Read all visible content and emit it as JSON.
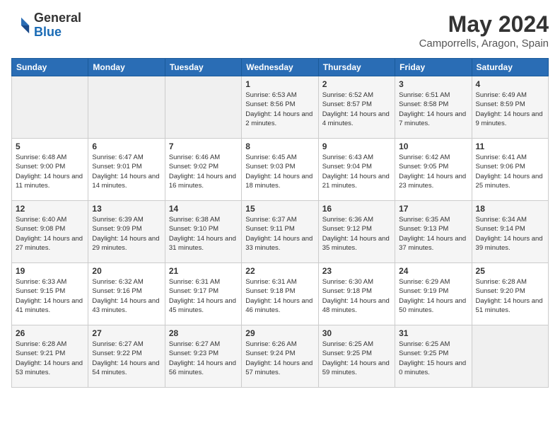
{
  "header": {
    "logo": {
      "general": "General",
      "blue": "Blue"
    },
    "title": "May 2024",
    "location": "Camporrells, Aragon, Spain"
  },
  "days_of_week": [
    "Sunday",
    "Monday",
    "Tuesday",
    "Wednesday",
    "Thursday",
    "Friday",
    "Saturday"
  ],
  "weeks": [
    [
      {
        "day": "",
        "data": null
      },
      {
        "day": "",
        "data": null
      },
      {
        "day": "",
        "data": null
      },
      {
        "day": "1",
        "data": {
          "sunrise": "6:53 AM",
          "sunset": "8:56 PM",
          "daylight": "14 hours and 2 minutes."
        }
      },
      {
        "day": "2",
        "data": {
          "sunrise": "6:52 AM",
          "sunset": "8:57 PM",
          "daylight": "14 hours and 4 minutes."
        }
      },
      {
        "day": "3",
        "data": {
          "sunrise": "6:51 AM",
          "sunset": "8:58 PM",
          "daylight": "14 hours and 7 minutes."
        }
      },
      {
        "day": "4",
        "data": {
          "sunrise": "6:49 AM",
          "sunset": "8:59 PM",
          "daylight": "14 hours and 9 minutes."
        }
      }
    ],
    [
      {
        "day": "5",
        "data": {
          "sunrise": "6:48 AM",
          "sunset": "9:00 PM",
          "daylight": "14 hours and 11 minutes."
        }
      },
      {
        "day": "6",
        "data": {
          "sunrise": "6:47 AM",
          "sunset": "9:01 PM",
          "daylight": "14 hours and 14 minutes."
        }
      },
      {
        "day": "7",
        "data": {
          "sunrise": "6:46 AM",
          "sunset": "9:02 PM",
          "daylight": "14 hours and 16 minutes."
        }
      },
      {
        "day": "8",
        "data": {
          "sunrise": "6:45 AM",
          "sunset": "9:03 PM",
          "daylight": "14 hours and 18 minutes."
        }
      },
      {
        "day": "9",
        "data": {
          "sunrise": "6:43 AM",
          "sunset": "9:04 PM",
          "daylight": "14 hours and 21 minutes."
        }
      },
      {
        "day": "10",
        "data": {
          "sunrise": "6:42 AM",
          "sunset": "9:05 PM",
          "daylight": "14 hours and 23 minutes."
        }
      },
      {
        "day": "11",
        "data": {
          "sunrise": "6:41 AM",
          "sunset": "9:06 PM",
          "daylight": "14 hours and 25 minutes."
        }
      }
    ],
    [
      {
        "day": "12",
        "data": {
          "sunrise": "6:40 AM",
          "sunset": "9:08 PM",
          "daylight": "14 hours and 27 minutes."
        }
      },
      {
        "day": "13",
        "data": {
          "sunrise": "6:39 AM",
          "sunset": "9:09 PM",
          "daylight": "14 hours and 29 minutes."
        }
      },
      {
        "day": "14",
        "data": {
          "sunrise": "6:38 AM",
          "sunset": "9:10 PM",
          "daylight": "14 hours and 31 minutes."
        }
      },
      {
        "day": "15",
        "data": {
          "sunrise": "6:37 AM",
          "sunset": "9:11 PM",
          "daylight": "14 hours and 33 minutes."
        }
      },
      {
        "day": "16",
        "data": {
          "sunrise": "6:36 AM",
          "sunset": "9:12 PM",
          "daylight": "14 hours and 35 minutes."
        }
      },
      {
        "day": "17",
        "data": {
          "sunrise": "6:35 AM",
          "sunset": "9:13 PM",
          "daylight": "14 hours and 37 minutes."
        }
      },
      {
        "day": "18",
        "data": {
          "sunrise": "6:34 AM",
          "sunset": "9:14 PM",
          "daylight": "14 hours and 39 minutes."
        }
      }
    ],
    [
      {
        "day": "19",
        "data": {
          "sunrise": "6:33 AM",
          "sunset": "9:15 PM",
          "daylight": "14 hours and 41 minutes."
        }
      },
      {
        "day": "20",
        "data": {
          "sunrise": "6:32 AM",
          "sunset": "9:16 PM",
          "daylight": "14 hours and 43 minutes."
        }
      },
      {
        "day": "21",
        "data": {
          "sunrise": "6:31 AM",
          "sunset": "9:17 PM",
          "daylight": "14 hours and 45 minutes."
        }
      },
      {
        "day": "22",
        "data": {
          "sunrise": "6:31 AM",
          "sunset": "9:18 PM",
          "daylight": "14 hours and 46 minutes."
        }
      },
      {
        "day": "23",
        "data": {
          "sunrise": "6:30 AM",
          "sunset": "9:18 PM",
          "daylight": "14 hours and 48 minutes."
        }
      },
      {
        "day": "24",
        "data": {
          "sunrise": "6:29 AM",
          "sunset": "9:19 PM",
          "daylight": "14 hours and 50 minutes."
        }
      },
      {
        "day": "25",
        "data": {
          "sunrise": "6:28 AM",
          "sunset": "9:20 PM",
          "daylight": "14 hours and 51 minutes."
        }
      }
    ],
    [
      {
        "day": "26",
        "data": {
          "sunrise": "6:28 AM",
          "sunset": "9:21 PM",
          "daylight": "14 hours and 53 minutes."
        }
      },
      {
        "day": "27",
        "data": {
          "sunrise": "6:27 AM",
          "sunset": "9:22 PM",
          "daylight": "14 hours and 54 minutes."
        }
      },
      {
        "day": "28",
        "data": {
          "sunrise": "6:27 AM",
          "sunset": "9:23 PM",
          "daylight": "14 hours and 56 minutes."
        }
      },
      {
        "day": "29",
        "data": {
          "sunrise": "6:26 AM",
          "sunset": "9:24 PM",
          "daylight": "14 hours and 57 minutes."
        }
      },
      {
        "day": "30",
        "data": {
          "sunrise": "6:25 AM",
          "sunset": "9:25 PM",
          "daylight": "14 hours and 59 minutes."
        }
      },
      {
        "day": "31",
        "data": {
          "sunrise": "6:25 AM",
          "sunset": "9:25 PM",
          "daylight": "15 hours and 0 minutes."
        }
      },
      {
        "day": "",
        "data": null
      }
    ]
  ]
}
